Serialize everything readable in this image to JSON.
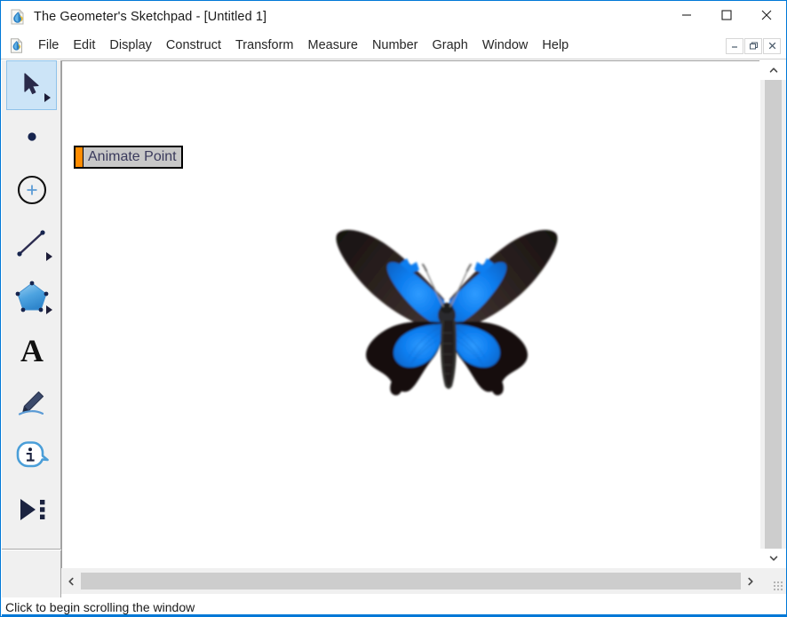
{
  "window": {
    "title": "The Geometer's Sketchpad - [Untitled 1]",
    "app_icon": "sketchpad-document-icon",
    "accent_color": "#0078d7",
    "controls": [
      {
        "name": "minimize-button",
        "icon": "minimize-icon",
        "label": "Minimize"
      },
      {
        "name": "maximize-button",
        "icon": "maximize-icon",
        "label": "Maximize"
      },
      {
        "name": "close-button",
        "icon": "close-icon",
        "label": "Close"
      }
    ]
  },
  "menu": {
    "doc_icon": "document-icon",
    "items": [
      {
        "label": "File"
      },
      {
        "label": "Edit"
      },
      {
        "label": "Display"
      },
      {
        "label": "Construct"
      },
      {
        "label": "Transform"
      },
      {
        "label": "Measure"
      },
      {
        "label": "Number"
      },
      {
        "label": "Graph"
      },
      {
        "label": "Window"
      },
      {
        "label": "Help"
      }
    ],
    "mdi_controls": [
      {
        "name": "mdi-minimize-button",
        "icon": "minimize-icon",
        "glyph": "–"
      },
      {
        "name": "mdi-restore-button",
        "icon": "restore-icon",
        "glyph": "❐"
      },
      {
        "name": "mdi-close-button",
        "icon": "close-icon",
        "glyph": "×"
      }
    ]
  },
  "toolbox": {
    "tools": [
      {
        "name": "arrow-select-tool",
        "icon": "arrow-cursor-icon",
        "label": "Arrow Tool",
        "selected": true,
        "has_flyout": true
      },
      {
        "name": "point-tool",
        "icon": "point-icon",
        "label": "Point Tool",
        "selected": false,
        "has_flyout": false
      },
      {
        "name": "compass-tool",
        "icon": "circle-compass-icon",
        "label": "Compass Tool",
        "selected": false,
        "has_flyout": false
      },
      {
        "name": "straightedge-tool",
        "icon": "line-segment-icon",
        "label": "Straightedge Tool",
        "selected": false,
        "has_flyout": true
      },
      {
        "name": "polygon-tool",
        "icon": "pentagon-icon",
        "label": "Polygon Tool",
        "selected": false,
        "has_flyout": true
      },
      {
        "name": "text-tool",
        "icon": "letter-a-icon",
        "label": "Text Tool",
        "selected": false,
        "has_flyout": false
      },
      {
        "name": "marker-tool",
        "icon": "marker-pen-icon",
        "label": "Marker Tool",
        "selected": false,
        "has_flyout": false
      },
      {
        "name": "information-tool",
        "icon": "info-bubble-icon",
        "label": "Information Tool",
        "selected": false,
        "has_flyout": false
      },
      {
        "name": "custom-tool",
        "icon": "play-triangle-dots-icon",
        "label": "Custom Tools",
        "selected": false,
        "has_flyout": false
      }
    ]
  },
  "canvas": {
    "action_button": {
      "label": "Animate Point",
      "accent_color": "#ff8c00",
      "fill_color": "#c8c8c8",
      "text_color": "#3a3a5c"
    },
    "image": {
      "name": "butterfly-image",
      "description": "Ulysses swallowtail butterfly",
      "wing_blue": "#0e7ef0",
      "wing_black": "#140f12",
      "wing_brown": "#3a2f30"
    }
  },
  "scrollbars": {
    "vertical": {
      "up_icon": "chevron-up-icon",
      "down_icon": "chevron-down-icon"
    },
    "horizontal": {
      "left_icon": "chevron-left-icon",
      "right_icon": "chevron-right-icon"
    }
  },
  "status": {
    "message": "Click to begin scrolling the window"
  }
}
